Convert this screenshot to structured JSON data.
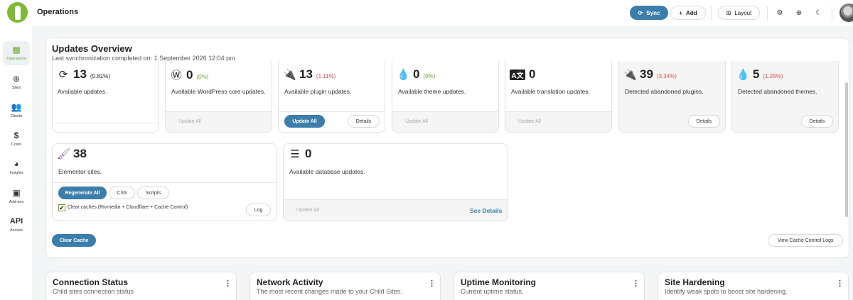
{
  "header": {
    "title": "Operations",
    "sync_label": "Sync",
    "add_label": "Add",
    "layout_label": "Layout"
  },
  "sidebar": {
    "items": [
      {
        "label": "Operations",
        "icon": "grid-icon",
        "active": true
      },
      {
        "label": "Sites",
        "icon": "globe-icon"
      },
      {
        "label": "Clients",
        "icon": "users-icon"
      },
      {
        "label": "Costs",
        "icon": "dollar-icon"
      },
      {
        "label": "Insights",
        "icon": "pie-chart-icon"
      },
      {
        "label": "Add-ons",
        "icon": "box-icon"
      },
      {
        "label": "Access",
        "icon": "api-icon",
        "icon_text": "API"
      }
    ]
  },
  "updates": {
    "title": "Updates Overview",
    "subtitle": "Last synchronization completed on: 1 September 2026 12:04 pm",
    "cards": [
      {
        "icon": "refresh-icon",
        "count": "13",
        "pct": "(0.81%)",
        "desc": "Available updates."
      },
      {
        "icon": "wordpress-icon",
        "count": "0",
        "pct": "(0%)",
        "desc": "Available WordPress core updates.",
        "action": "Update All"
      },
      {
        "icon": "plug-icon",
        "count": "13",
        "pct": "(1.11%)",
        "desc": "Available plugin updates.",
        "action": "Update All",
        "details": "Details"
      },
      {
        "icon": "droplet-icon",
        "count": "0",
        "pct": "(0%)",
        "desc": "Available theme updates.",
        "action": "Update All"
      },
      {
        "icon": "translate-icon",
        "count": "0",
        "desc": "Available translation updates.",
        "action": "Update All"
      },
      {
        "icon": "abandoned-plugin-icon",
        "count": "39",
        "pct": "(3.34%)",
        "desc": "Detected abandoned plugins.",
        "details": "Details"
      },
      {
        "icon": "abandoned-theme-icon",
        "count": "5",
        "pct": "(1.29%)",
        "desc": "Detected abandoned themes.",
        "details": "Details"
      }
    ],
    "elementor": {
      "icon": "brush-icon",
      "count": "38",
      "desc": "Elementor sites.",
      "regenerate": "Regenerate All",
      "css": "CSS",
      "scripts": "Scripts",
      "checkbox_label": "Clear caches (Rivmedia + Cloudflare + Cache Control)",
      "log": "Log"
    },
    "database": {
      "icon": "database-icon",
      "count": "0",
      "desc": "Available database updates.",
      "action": "Update All",
      "see_details": "See Details"
    },
    "clear_cache": "Clear Cache",
    "view_logs": "View Cache Control Logs"
  },
  "widgets": [
    {
      "title": "Connection Status",
      "subtitle": "Child sites connection status"
    },
    {
      "title": "Network Activity",
      "subtitle": "The most recent changes made to your Child Sites."
    },
    {
      "title": "Uptime Monitoring",
      "subtitle": "Current uptime status."
    },
    {
      "title": "Site Hardening",
      "subtitle": "Identify weak spots to boost site hardening."
    }
  ]
}
